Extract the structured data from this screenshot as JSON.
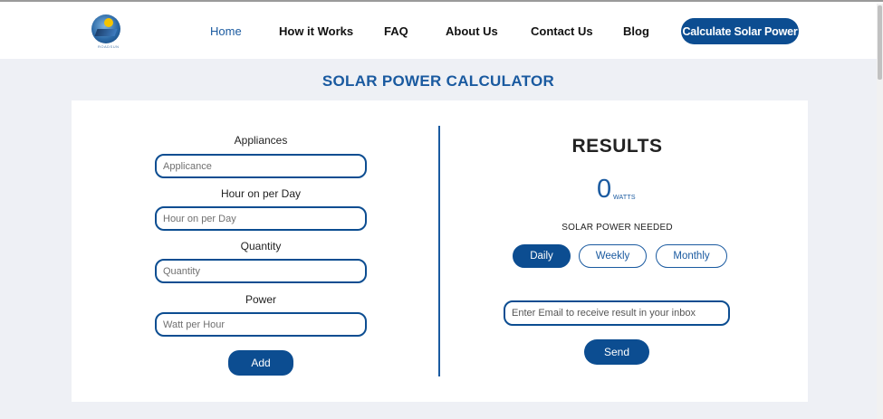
{
  "nav": {
    "logo_caption": "ROADSUN",
    "links": [
      "Home",
      "How it Works",
      "FAQ",
      "About Us",
      "Contact Us",
      "Blog"
    ],
    "active": "Home",
    "cta_label": "Calculate Solar Power"
  },
  "page": {
    "title": "SOLAR POWER CALCULATOR"
  },
  "form": {
    "appliances_label": "Appliances",
    "appliances_placeholder": "Applicance",
    "hours_label": "Hour on per Day",
    "hours_placeholder": "Hour on per Day",
    "quantity_label": "Quantity",
    "quantity_placeholder": "Quantity",
    "power_label": "Power",
    "power_placeholder": "Watt per Hour",
    "add_label": "Add"
  },
  "results": {
    "title": "RESULTS",
    "value": "0",
    "unit": "WATTS",
    "needed_label": "SOLAR POWER NEEDED",
    "periods": [
      "Daily",
      "Weekly",
      "Monthly"
    ],
    "selected_period": "Daily",
    "email_placeholder": "Enter Email to receive result in your inbox",
    "send_label": "Send"
  },
  "colors": {
    "primary": "#0c4d91",
    "accent_text": "#1a5aa0",
    "background": "#eef0f5"
  }
}
